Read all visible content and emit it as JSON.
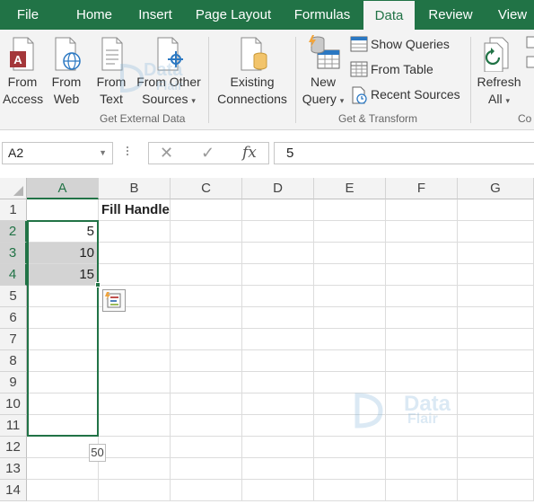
{
  "tabs": [
    {
      "label": "File",
      "active": false
    },
    {
      "label": "Home",
      "active": false
    },
    {
      "label": "Insert",
      "active": false
    },
    {
      "label": "Page Layout",
      "active": false
    },
    {
      "label": "Formulas",
      "active": false
    },
    {
      "label": "Data",
      "active": true
    },
    {
      "label": "Review",
      "active": false
    },
    {
      "label": "View",
      "active": false
    }
  ],
  "ribbon": {
    "get_external_data": {
      "group_label": "Get External Data",
      "from_access": {
        "line1": "From",
        "line2": "Access"
      },
      "from_web": {
        "line1": "From",
        "line2": "Web"
      },
      "from_text": {
        "line1": "From",
        "line2": "Text"
      },
      "from_other_sources": {
        "line1": "From Other",
        "line2": "Sources"
      },
      "existing_connections": {
        "line1": "Existing",
        "line2": "Connections"
      }
    },
    "get_transform": {
      "group_label": "Get & Transform",
      "new_query": {
        "line1": "New",
        "line2": "Query"
      },
      "show_queries": "Show Queries",
      "from_table": "From Table",
      "recent_sources": "Recent Sources"
    },
    "connections": {
      "group_label": "Co",
      "refresh_all": {
        "line1": "Refresh",
        "line2": "All"
      }
    }
  },
  "formula_bar": {
    "name_box": "A2",
    "cancel_symbol": "✕",
    "enter_symbol": "✓",
    "fx_symbol": "fx",
    "value": "5"
  },
  "sheet": {
    "columns": [
      "A",
      "B",
      "C",
      "D",
      "E",
      "F",
      "G"
    ],
    "rows": [
      "1",
      "2",
      "3",
      "4",
      "5",
      "6",
      "7",
      "8",
      "9",
      "10",
      "11",
      "12",
      "13",
      "14"
    ],
    "cells": {
      "B1": "Fill Handle",
      "A2": "5",
      "A3": "10",
      "A4": "15"
    },
    "fill_preview": "50"
  },
  "watermark": {
    "line1": "Data",
    "line2": "Flair"
  },
  "colors": {
    "accent": "#217346",
    "selection_shade": "#d3d3d3",
    "ribbon_bg": "#f3f3f3"
  }
}
